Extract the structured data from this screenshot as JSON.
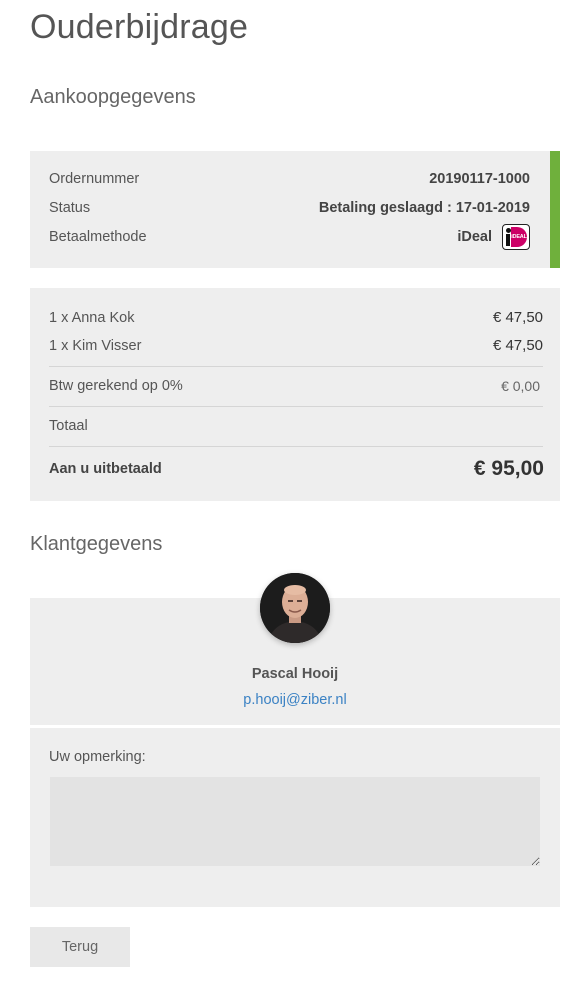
{
  "page": {
    "title": "Ouderbijdrage"
  },
  "purchase": {
    "section_title": "Aankoopgegevens",
    "status_color": "#6fb03c",
    "order_number_label": "Ordernummer",
    "order_number": "20190117-1000",
    "status_label": "Status",
    "status_value": "Betaling geslaagd : 17-01-2019",
    "payment_method_label": "Betaalmethode",
    "payment_method": "iDeal",
    "payment_icon_text": "iDEAL"
  },
  "lines": {
    "items": [
      {
        "label": "1 x Anna Kok",
        "amount": "€ 47,50"
      },
      {
        "label": "1 x Kim Visser",
        "amount": "€ 47,50"
      }
    ],
    "vat_label": "Btw gerekend op 0%",
    "vat_amount": "€ 0,00",
    "total_label": "Totaal",
    "paid_label": "Aan u uitbetaald",
    "paid_amount": "€ 95,00"
  },
  "customer": {
    "section_title": "Klantgegevens",
    "name": "Pascal Hooij",
    "email": "p.hooij@ziber.nl"
  },
  "remark": {
    "label": "Uw opmerking:",
    "value": ""
  },
  "actions": {
    "back_label": "Terug"
  }
}
